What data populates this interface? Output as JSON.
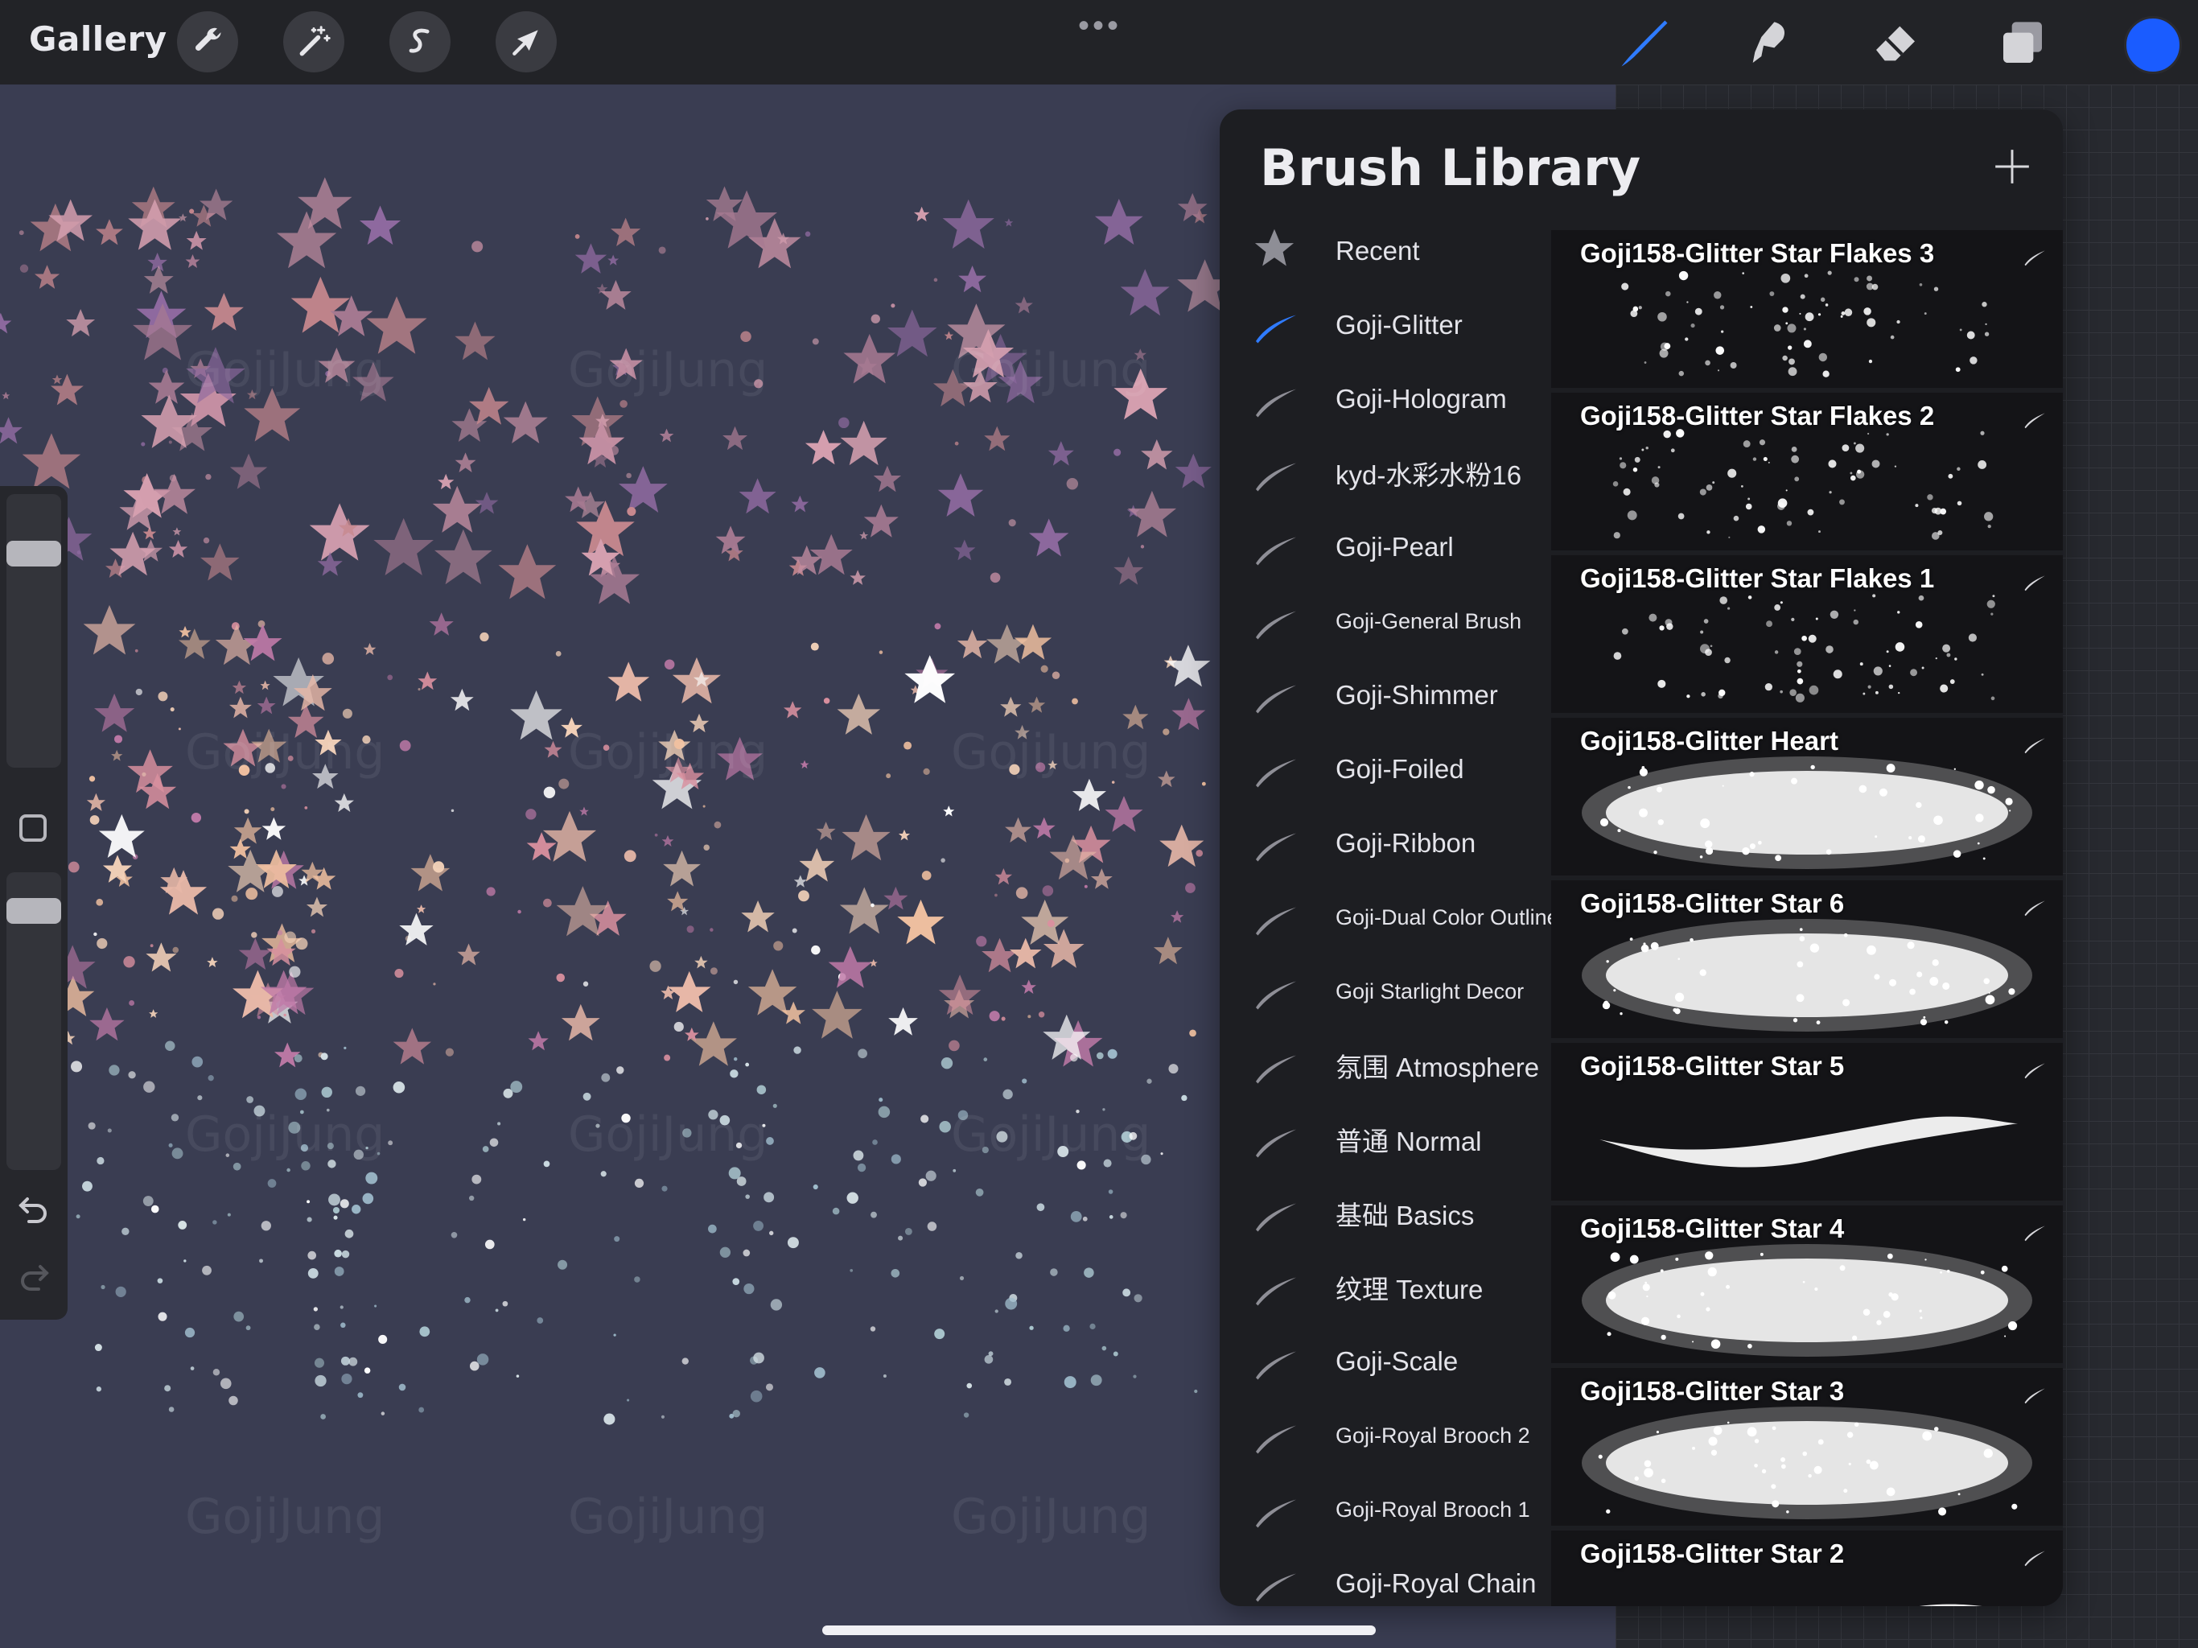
{
  "toolbar": {
    "gallery_label": "Gallery",
    "left_tools": [
      "wrench-icon",
      "magic-wand-icon",
      "selection-s-icon",
      "transform-arrow-icon"
    ],
    "more_label": "•••",
    "right_tools": [
      "brush-icon",
      "smudge-icon",
      "eraser-icon",
      "layers-icon"
    ],
    "active_color": "#1a5cff"
  },
  "canvas": {
    "watermark_text": "GojiJung"
  },
  "sidebar": {
    "undo_icon": "undo-icon",
    "redo_icon": "redo-icon"
  },
  "brush_library": {
    "title": "Brush Library",
    "add_icon": "plus-icon",
    "categories": [
      {
        "label": "Recent",
        "icon": "star-icon"
      },
      {
        "label": "Goji-Glitter",
        "icon": "brush-stroke-icon",
        "selected": true
      },
      {
        "label": "Goji-Hologram",
        "icon": "brush-stroke-icon"
      },
      {
        "label": "kyd-水彩水粉16",
        "icon": "brush-stroke-icon"
      },
      {
        "label": "Goji-Pearl",
        "icon": "brush-stroke-icon"
      },
      {
        "label": "Goji-General Brush",
        "icon": "brush-stroke-icon",
        "small": true
      },
      {
        "label": "Goji-Shimmer",
        "icon": "brush-stroke-icon"
      },
      {
        "label": "Goji-Foiled",
        "icon": "brush-stroke-icon"
      },
      {
        "label": "Goji-Ribbon",
        "icon": "brush-stroke-icon"
      },
      {
        "label": "Goji-Dual Color Outline",
        "icon": "brush-stroke-icon",
        "small": true
      },
      {
        "label": "Goji Starlight Decor",
        "icon": "brush-stroke-icon",
        "small": true
      },
      {
        "label": "氛围 Atmosphere",
        "icon": "brush-stroke-icon"
      },
      {
        "label": "普通 Normal",
        "icon": "brush-stroke-icon"
      },
      {
        "label": "基础 Basics",
        "icon": "brush-stroke-icon"
      },
      {
        "label": "纹理 Texture",
        "icon": "brush-stroke-icon"
      },
      {
        "label": "Goji-Scale",
        "icon": "brush-stroke-icon"
      },
      {
        "label": "Goji-Royal Brooch 2",
        "icon": "brush-stroke-icon",
        "small": true
      },
      {
        "label": "Goji-Royal Brooch 1",
        "icon": "brush-stroke-icon",
        "small": true
      },
      {
        "label": "Goji-Royal Chain",
        "icon": "brush-stroke-icon"
      }
    ],
    "brushes": [
      {
        "name": "Goji158-Glitter Star Flakes 3",
        "style": "sparse"
      },
      {
        "name": "Goji158-Glitter Star Flakes 2",
        "style": "sparse"
      },
      {
        "name": "Goji158-Glitter Star Flakes 1",
        "style": "sparse"
      },
      {
        "name": "Goji158-Glitter Heart",
        "style": "heavy"
      },
      {
        "name": "Goji158-Glitter Star 6",
        "style": "heavy"
      },
      {
        "name": "Goji158-Glitter Star 5",
        "style": "line"
      },
      {
        "name": "Goji158-Glitter Star 4",
        "style": "heavy"
      },
      {
        "name": "Goji158-Glitter Star 3",
        "style": "heavy"
      },
      {
        "name": "Goji158-Glitter Star 2",
        "style": "line"
      }
    ]
  }
}
